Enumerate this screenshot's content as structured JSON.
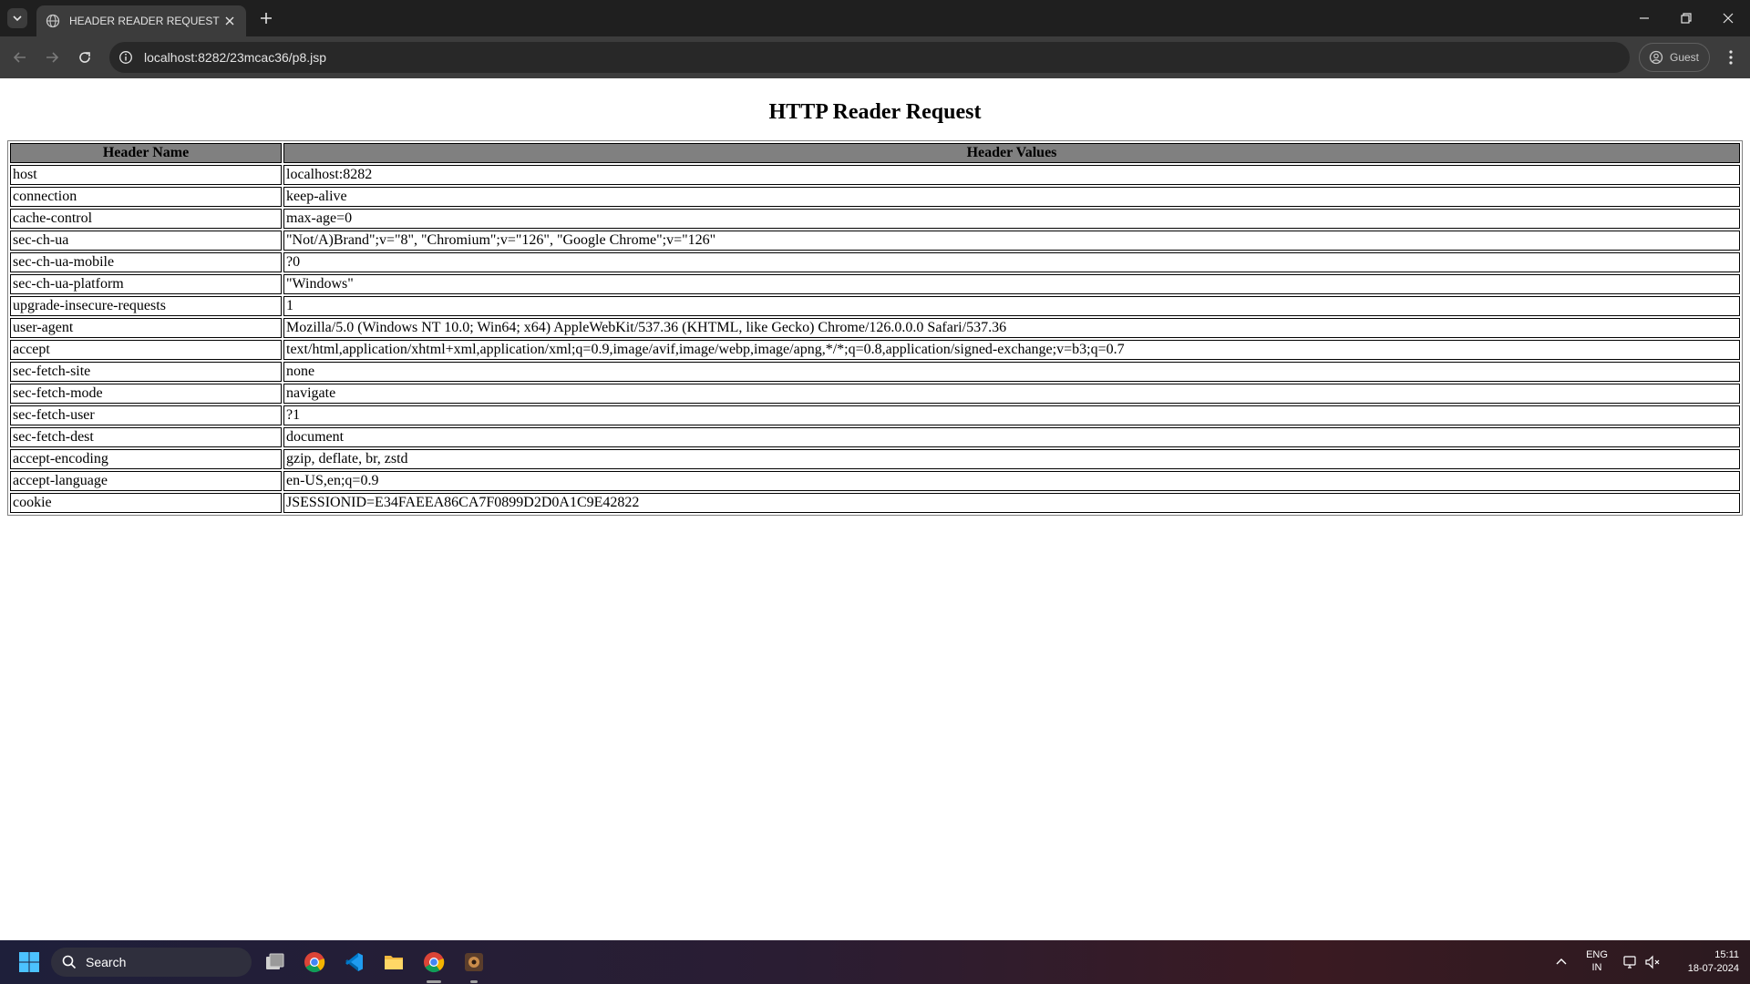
{
  "browser": {
    "tab": {
      "title": "HEADER READER REQUEST"
    },
    "address_bar": {
      "url": "localhost:8282/23mcac36/p8.jsp"
    },
    "profile": {
      "label": "Guest"
    }
  },
  "page": {
    "heading": "HTTP Reader Request",
    "table": {
      "columns": [
        "Header Name",
        "Header Values"
      ],
      "rows": [
        {
          "name": "host",
          "value": "localhost:8282"
        },
        {
          "name": "connection",
          "value": "keep-alive"
        },
        {
          "name": "cache-control",
          "value": "max-age=0"
        },
        {
          "name": "sec-ch-ua",
          "value": "\"Not/A)Brand\";v=\"8\", \"Chromium\";v=\"126\", \"Google Chrome\";v=\"126\""
        },
        {
          "name": "sec-ch-ua-mobile",
          "value": "?0"
        },
        {
          "name": "sec-ch-ua-platform",
          "value": "\"Windows\""
        },
        {
          "name": "upgrade-insecure-requests",
          "value": "1"
        },
        {
          "name": "user-agent",
          "value": "Mozilla/5.0 (Windows NT 10.0; Win64; x64) AppleWebKit/537.36 (KHTML, like Gecko) Chrome/126.0.0.0 Safari/537.36"
        },
        {
          "name": "accept",
          "value": "text/html,application/xhtml+xml,application/xml;q=0.9,image/avif,image/webp,image/apng,*/*;q=0.8,application/signed-exchange;v=b3;q=0.7"
        },
        {
          "name": "sec-fetch-site",
          "value": "none"
        },
        {
          "name": "sec-fetch-mode",
          "value": "navigate"
        },
        {
          "name": "sec-fetch-user",
          "value": "?1"
        },
        {
          "name": "sec-fetch-dest",
          "value": "document"
        },
        {
          "name": "accept-encoding",
          "value": "gzip, deflate, br, zstd"
        },
        {
          "name": "accept-language",
          "value": "en-US,en;q=0.9"
        },
        {
          "name": "cookie",
          "value": "JSESSIONID=E34FAEEA86CA7F0899D2D0A1C9E42822"
        }
      ]
    }
  },
  "taskbar": {
    "search_label": "Search",
    "language": {
      "line1": "ENG",
      "line2": "IN"
    },
    "clock": {
      "time": "15:11",
      "date": "18-07-2024"
    },
    "icons": [
      "start-icon",
      "search-icon",
      "task-view-icon",
      "chrome-icon",
      "vscode-icon",
      "file-explorer-icon",
      "chrome-active-icon",
      "app-icon",
      "chevron-up-icon",
      "network-icon",
      "volume-muted-icon"
    ]
  },
  "colors": {
    "titlebar": "#1f1f1f",
    "toolbar": "#3c3c3c",
    "table_header_bg": "#808080"
  }
}
